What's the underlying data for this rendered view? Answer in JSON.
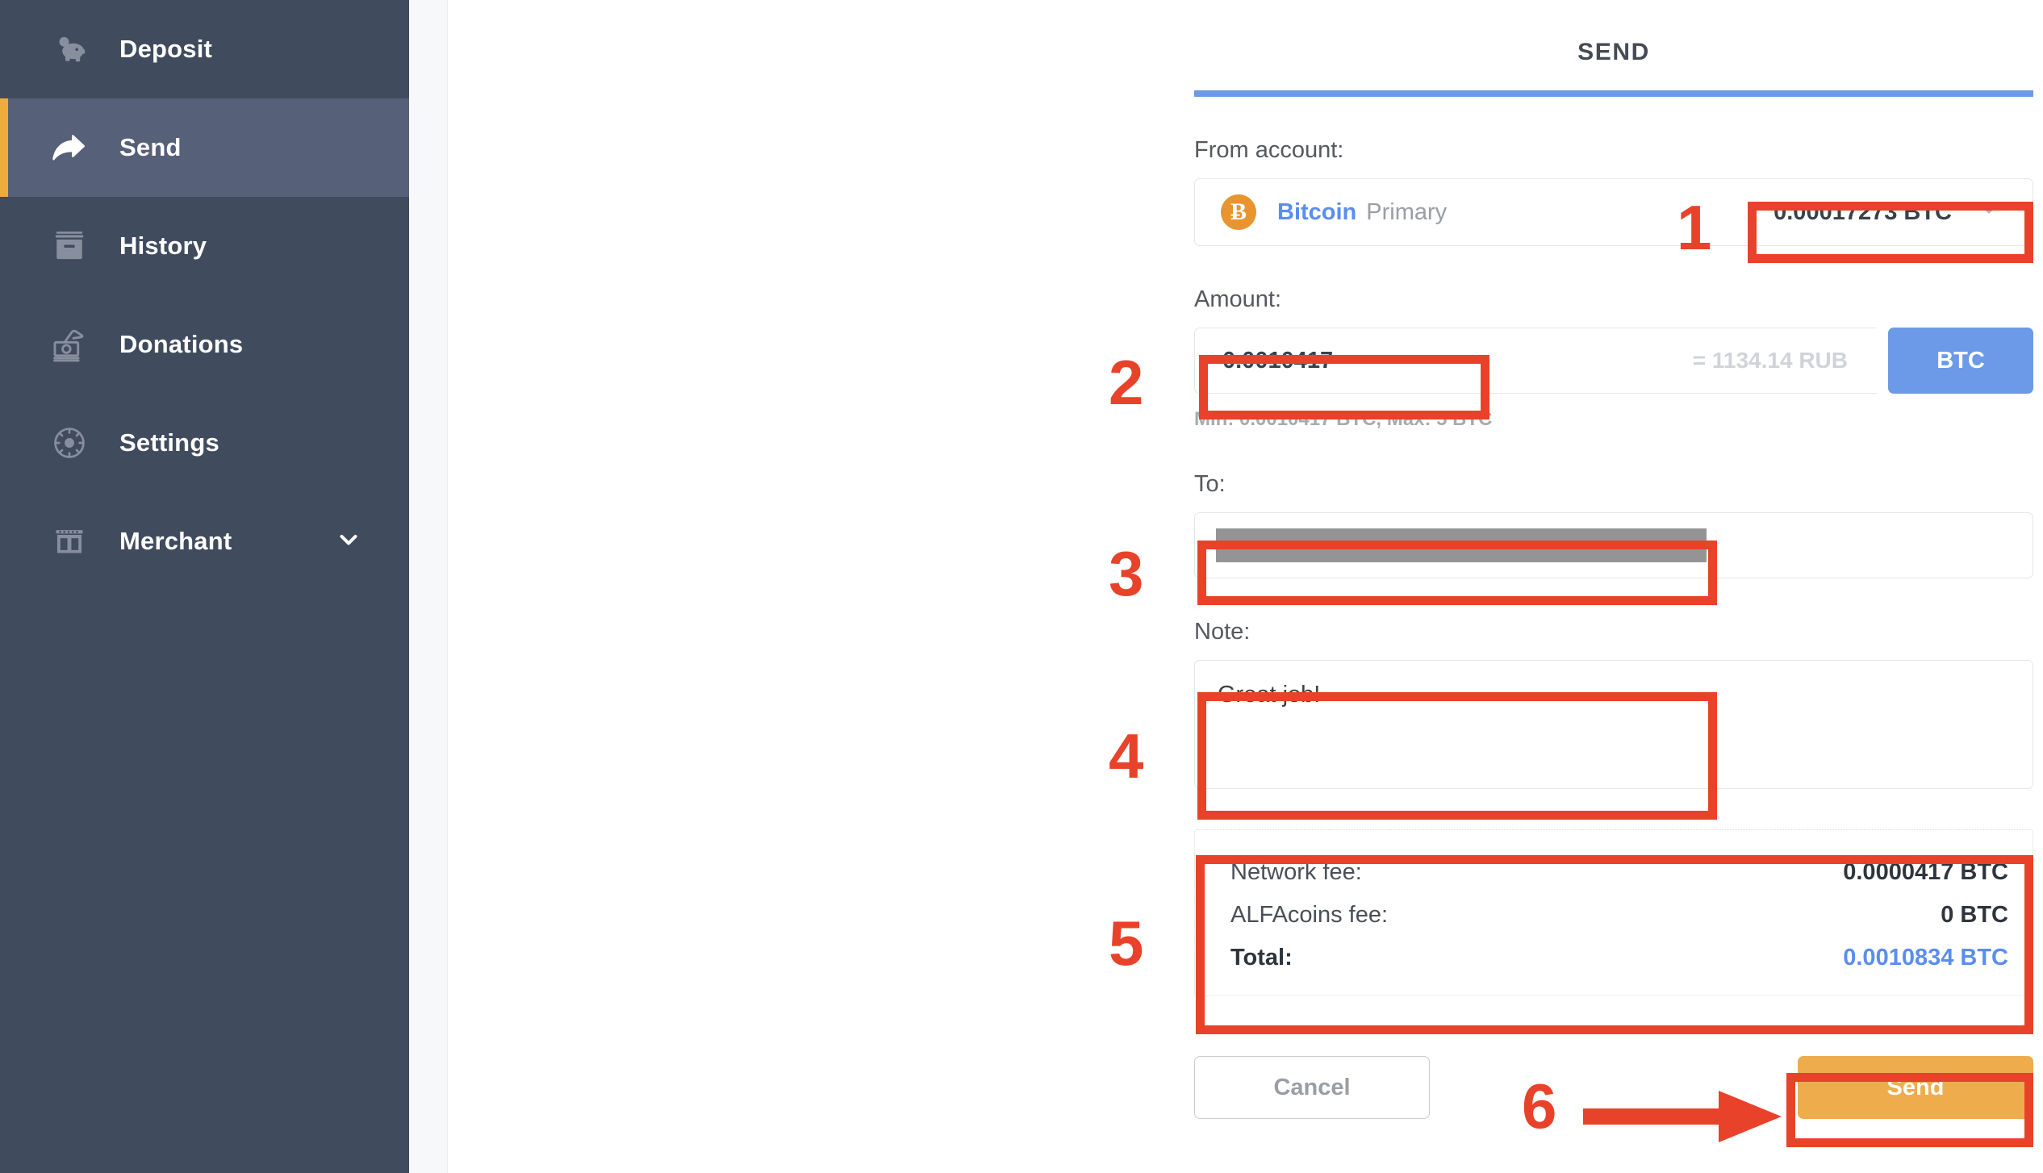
{
  "sidebar": {
    "items": [
      {
        "label": "Deposit",
        "icon": "piggy-bank-icon",
        "active": false,
        "chevron": false
      },
      {
        "label": "Send",
        "icon": "share-arrow-icon",
        "active": true,
        "chevron": false
      },
      {
        "label": "History",
        "icon": "archive-box-icon",
        "active": false,
        "chevron": false
      },
      {
        "label": "Donations",
        "icon": "hand-coin-icon",
        "active": false,
        "chevron": false
      },
      {
        "label": "Settings",
        "icon": "gear-icon",
        "active": false,
        "chevron": false
      },
      {
        "label": "Merchant",
        "icon": "store-icon",
        "active": false,
        "chevron": true
      }
    ]
  },
  "form": {
    "title": "SEND",
    "from_account_label": "From account:",
    "account": {
      "coin_symbol": "Ƀ",
      "name": "Bitcoin",
      "type": "Primary",
      "balance": "0.00017273 BTC"
    },
    "amount_label": "Amount:",
    "amount_value": "0.0010417",
    "amount_conversion": "= 1134.14 RUB",
    "currency_toggle": "BTC",
    "amount_hint": "Min: 0.0010417 BTC, Max: 5 BTC",
    "to_label": "To:",
    "to_value": "",
    "note_label": "Note:",
    "note_value": "Great job!",
    "fees": [
      {
        "label": "Network fee:",
        "value": "0.0000417 BTC",
        "total": false
      },
      {
        "label": "ALFAcoins fee:",
        "value": "0 BTC",
        "total": false
      },
      {
        "label": "Total:",
        "value": "0.0010834 BTC",
        "total": true
      }
    ],
    "cancel_label": "Cancel",
    "send_label": "Send"
  },
  "annotations": {
    "numbers": [
      "1",
      "2",
      "3",
      "4",
      "5",
      "6"
    ]
  },
  "colors": {
    "sidebar_bg": "#414b5e",
    "sidebar_active_bg": "#566078",
    "accent_orange": "#eeac3d",
    "accent_blue": "#6c9ae8",
    "link_blue": "#5b8def",
    "bitcoin_orange": "#e8942f",
    "annotation_red": "#e8422a"
  }
}
